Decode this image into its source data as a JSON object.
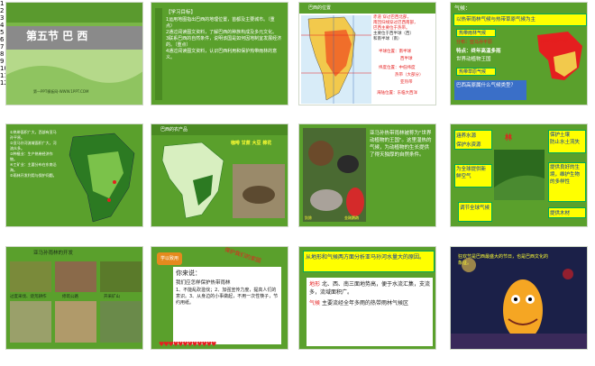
{
  "slides": [
    {
      "num": "1",
      "title": "第五节  巴 西",
      "footer": "第一PPT模板网-WWW.1PPT.COM"
    },
    {
      "num": "2",
      "heading": "【学习目标】",
      "body": "1运用地图指出巴西的地理位置，首都及主要城市。（重点）\n2通过阅读图文资料，了解巴西的种族构成及多元文化。\n3联系巴西的自然条件，说明该国是如何因地制宜发展经济的。（重点）\n4通过阅读图文资料，认识巴西利用和保护热带雨林的意义。"
    },
    {
      "num": "3",
      "heading": "巴西的位置",
      "l1": "赤道  穿过巴西北部，",
      "l2": "南回归线穿过巴西南部，",
      "l3": "巴西主要位于热带。",
      "l4": "主要位于西半球（西）",
      "l5": "和南半球（南）",
      "r1": "半球位置：南半球",
      "r2": "西半球",
      "r3": "纬度位置：中低纬度",
      "r4": "热带（大部分）",
      "r5": "亚热带",
      "r6": "海陆位置：东临大西洋"
    },
    {
      "num": "4",
      "q": "气候：",
      "a1": "以热带雨林气候与热带草原气候为主",
      "a2": "热带雨林气候",
      "a3": "分布：亚马孙平原",
      "a4": "特点：终年高温多雨",
      "a5": "世界动植物王国",
      "a6": "热带草原气候",
      "a7": "巴西高原属什么气候类型？",
      "tag": "热带草原气候"
    },
    {
      "num": "5",
      "body": "①热带面积广大，西部有亚马孙平原。\n②亚马孙河流域面积广大，河流众多。\n③种植业：生产热带经济作物。\n④工矿业：主要分布在东南沿海。\n⑤雨林开发利用与保护问题。"
    },
    {
      "num": "6",
      "heading": "巴西的农产品",
      "crops": "咖啡 甘蔗 大豆 棉花"
    },
    {
      "num": "7",
      "body": "亚马孙热带雨林被称为\"世界动植物的王国\"。这里湿热的气候，为动植物的生长提供了得天独厚的自然条件。",
      "lbl1": "犰狳",
      "lbl2": "金刚鹦鹉"
    },
    {
      "num": "8",
      "b1": "涵养水源",
      "b2": "保护水资源",
      "b3": "保护土壤",
      "b4": "防止水土流失",
      "b5": "为全球提供新鲜空气",
      "b6": "提供良好的生境，维护生物的多样性",
      "b7": "调节全球气候",
      "b8": "提供木材",
      "center": "林"
    },
    {
      "num": "9",
      "heading": "亚马孙雨林的开发",
      "c1": "过度采伐、烧荒耕作",
      "c2": "修筑公路",
      "c3": "开采矿山"
    },
    {
      "num": "10",
      "tag": "学以致用",
      "speech": "你来说：",
      "l1": "我们应怎样保护热带雨林",
      "l2": "1、不能乱砍滥伐；2、加强宣传力度，提高人们的意识。3、从身边的小事做起，不用一次性筷子，节约用纸。",
      "arc": "保护我们的家园"
    },
    {
      "num": "11",
      "head": "从地形和气候两方面分析亚马孙河水量大的原因。",
      "t1": "地形",
      "t1b": "北、西、南三面地势高，便于水流汇集，支流多，流域面积广。",
      "t2": "气候",
      "t2b": "主要流经全年多雨的热带雨林气候区"
    },
    {
      "num": "12",
      "text": "狂欢节是巴西最盛大的节日，也是巴西文化的象征。"
    }
  ],
  "colors": {
    "slide_green": "#5aa02c",
    "dark_green": "#3e7a1d",
    "title_bar": "#8a8a8a",
    "accent_yellow": "#ffff00",
    "accent_red": "#e51f1f",
    "ocean_blue": "#2f5fb0"
  }
}
